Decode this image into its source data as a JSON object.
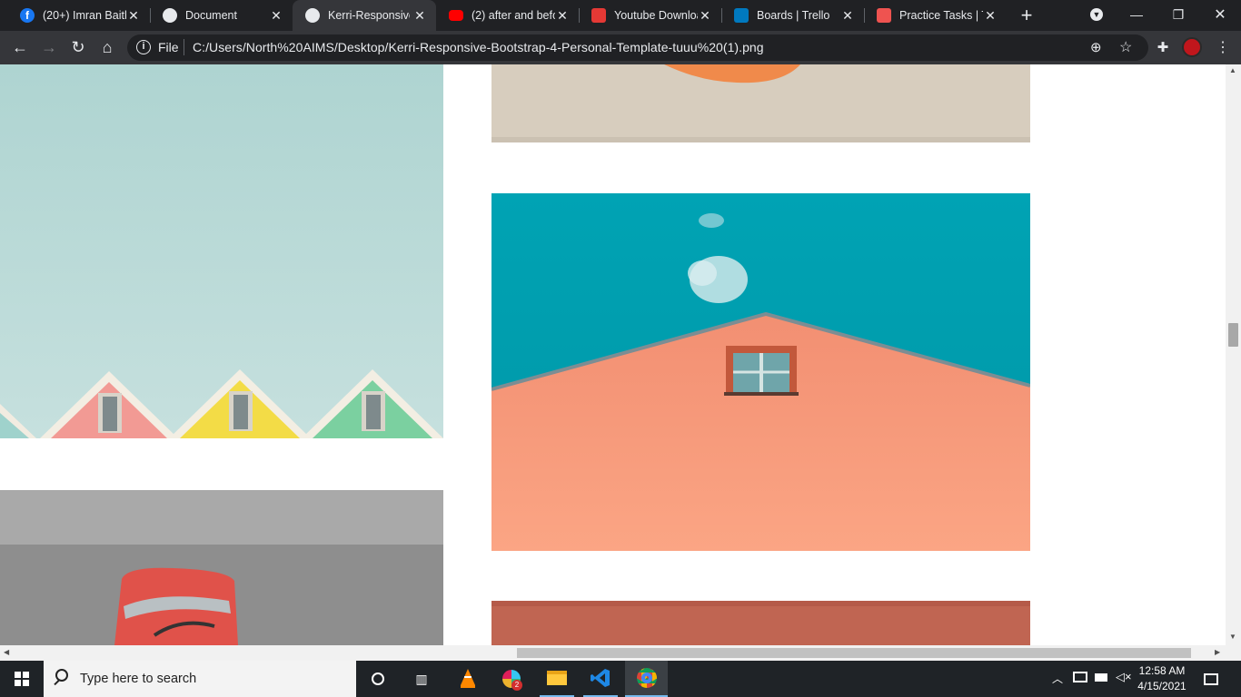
{
  "browser": {
    "tabs": [
      {
        "title": "(20+) Imran Baith",
        "favicon": "facebook-icon",
        "color": "#1877f2",
        "active": false
      },
      {
        "title": "Document",
        "favicon": "globe-icon",
        "color": "#e8eaed",
        "active": false
      },
      {
        "title": "Kerri-Responsive",
        "favicon": "globe-icon",
        "color": "#e8eaed",
        "active": true
      },
      {
        "title": "(2) after and befo",
        "favicon": "youtube-icon",
        "color": "#ff0000",
        "active": false
      },
      {
        "title": "Youtube Downloa",
        "favicon": "download-icon",
        "color": "#e53935",
        "active": false
      },
      {
        "title": "Boards | Trello",
        "favicon": "trello-icon",
        "color": "#0079bf",
        "active": false
      },
      {
        "title": "Practice Tasks | Tr",
        "favicon": "trello-icon",
        "color": "#ef5350",
        "active": false
      }
    ],
    "new_tab_label": "+",
    "address": {
      "scheme": "File",
      "url": "C:/Users/North%20AIMS/Desktop/Kerri-Responsive-Bootstrap-4-Personal-Template-tuuu%20(1).png"
    },
    "accent": "#35363a"
  },
  "page": {
    "images": [
      {
        "name": "mint-sky-rooftops-photo",
        "subject": "rooftops"
      },
      {
        "name": "beige-photo-with-orange-object",
        "subject": "orange-object"
      },
      {
        "name": "teal-sky-peach-building-photo",
        "subject": "building-window"
      },
      {
        "name": "grey-photo-red-object",
        "subject": "red-object"
      },
      {
        "name": "terracotta-wall-photo",
        "subject": "wall"
      }
    ]
  },
  "taskbar": {
    "search_placeholder": "Type here to search",
    "time": "12:58 AM",
    "date": "4/15/2021",
    "pinned": [
      "cortana-icon",
      "task-view-icon",
      "vlc-icon",
      "slack-icon",
      "file-explorer-icon",
      "vscode-icon",
      "chrome-icon"
    ],
    "slack_badge": "2"
  }
}
